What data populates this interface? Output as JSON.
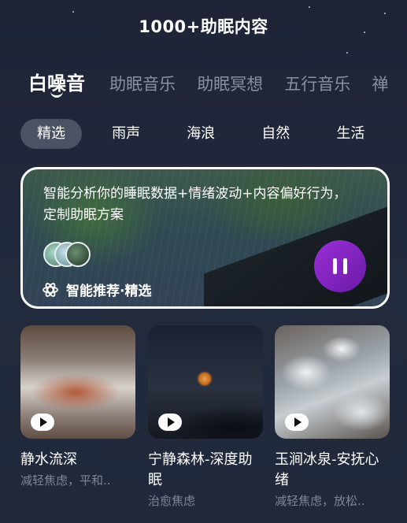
{
  "header": {
    "title": "1000+助眠内容"
  },
  "tabs": [
    {
      "label": "白噪音",
      "active": true
    },
    {
      "label": "助眠音乐",
      "active": false
    },
    {
      "label": "助眠冥想",
      "active": false
    },
    {
      "label": "五行音乐",
      "active": false
    },
    {
      "label": "禅",
      "active": false
    }
  ],
  "chips": [
    {
      "label": "精选",
      "active": true
    },
    {
      "label": "雨声",
      "active": false
    },
    {
      "label": "海浪",
      "active": false
    },
    {
      "label": "自然",
      "active": false
    },
    {
      "label": "生活",
      "active": false
    }
  ],
  "banner": {
    "description": "智能分析你的睡眠数据+情绪波动+内容偏好行为，定制助眠方案",
    "tag": "智能推荐·精选",
    "tag_icon": "atom-icon",
    "play_icon": "pause-icon"
  },
  "cards": [
    {
      "title": "静水流深",
      "subtitle": "减轻焦虑，平和.."
    },
    {
      "title": "宁静森林-深度助眠",
      "subtitle": "治愈焦虑"
    },
    {
      "title": "玉涧冰泉-安抚心绪",
      "subtitle": "减轻焦虑，放松.."
    }
  ],
  "colors": {
    "accent": "#8a25cc",
    "background": "#1f2536",
    "chip_active": "#4a5264"
  }
}
